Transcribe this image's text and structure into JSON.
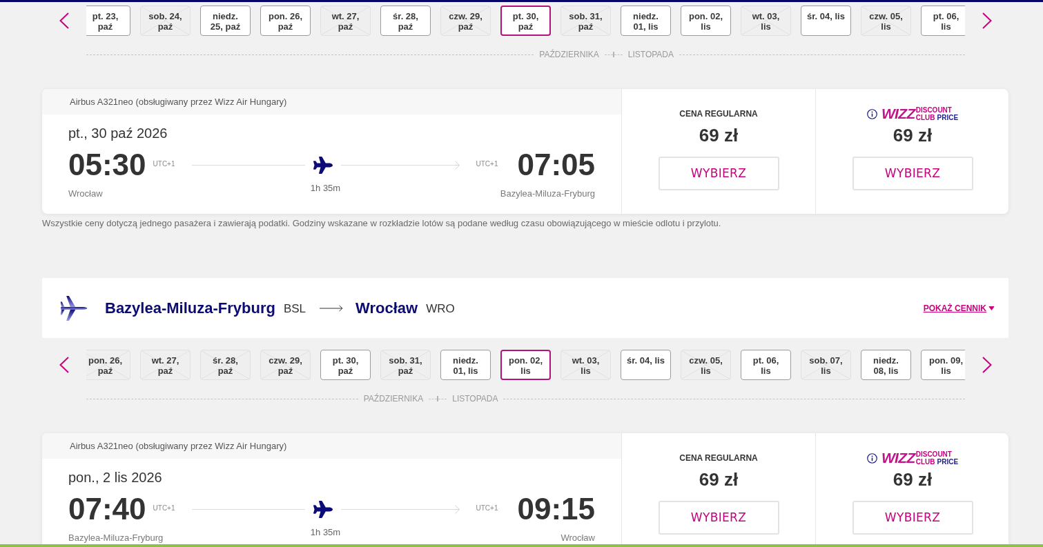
{
  "outbound": {
    "date_strip": {
      "months": [
        {
          "label": "PAŹDZIERNIKA",
          "dates": [
            {
              "label": "pt. 23,\npaź",
              "available": true,
              "selected": false
            },
            {
              "label": "sob. 24,\npaź",
              "available": false,
              "selected": false
            },
            {
              "label": "niedz.\n25, paź",
              "available": true,
              "selected": false
            },
            {
              "label": "pon. 26,\npaź",
              "available": true,
              "selected": false
            },
            {
              "label": "wt. 27,\npaź",
              "available": false,
              "selected": false
            },
            {
              "label": "śr. 28,\npaź",
              "available": true,
              "selected": false
            },
            {
              "label": "czw. 29,\npaź",
              "available": false,
              "selected": false
            },
            {
              "label": "pt. 30,\npaź",
              "available": true,
              "selected": true
            },
            {
              "label": "sob. 31,\npaź",
              "available": false,
              "selected": false
            }
          ]
        },
        {
          "label": "LISTOPADA",
          "dates": [
            {
              "label": "niedz.\n01, lis",
              "available": true,
              "selected": false
            },
            {
              "label": "pon. 02,\nlis",
              "available": true,
              "selected": false
            },
            {
              "label": "wt. 03,\nlis",
              "available": false,
              "selected": false
            },
            {
              "label": "śr. 04, lis",
              "available": true,
              "selected": false
            },
            {
              "label": "czw. 05,\nlis",
              "available": false,
              "selected": false
            },
            {
              "label": "pt. 06,\nlis",
              "available": true,
              "selected": false
            }
          ]
        }
      ]
    },
    "flight": {
      "aircraft": "Airbus A321neo (obsługiwany przez Wizz Air Hungary)",
      "date": "pt., 30 paź 2026",
      "departure": {
        "time": "05:30",
        "timezone": "UTC+1",
        "city": "Wrocław"
      },
      "duration": "1h 35m",
      "arrival": {
        "time": "07:05",
        "timezone": "UTC+1",
        "city": "Bazylea-Miluza-Fryburg"
      },
      "fares": [
        {
          "kind": "regular",
          "label": "CENA REGULARNA",
          "price": "69 zł",
          "button": "WYBIERZ"
        },
        {
          "kind": "club",
          "logo": {
            "wordmark": "WIZZ",
            "top_line": "DISCOUNT",
            "bottom_line": "CLUB",
            "bottom_line_accent": "PRICE"
          },
          "price": "69 zł",
          "button": "WYBIERZ"
        }
      ]
    },
    "note": "Wszystkie ceny dotyczą jednego pasażera i zawierają podatki. Godziny wskazane w rozkładzie lotów są podane według czasu obowiązującego w mieście odlotu i przylotu."
  },
  "inbound": {
    "route": {
      "origin": {
        "city": "Bazylea-Miluza-Fryburg",
        "code": "BSL"
      },
      "destination": {
        "city": "Wrocław",
        "code": "WRO"
      },
      "price_link": "POKAŻ CENNIK"
    },
    "date_strip": {
      "months": [
        {
          "label": "PAŹDZIERNIKA",
          "dates": [
            {
              "label": "pon. 26,\npaź",
              "available": false,
              "selected": false
            },
            {
              "label": "wt. 27,\npaź",
              "available": false,
              "selected": false
            },
            {
              "label": "śr. 28,\npaź",
              "available": false,
              "selected": false
            },
            {
              "label": "czw. 29,\npaź",
              "available": false,
              "selected": false
            },
            {
              "label": "pt. 30,\npaź",
              "available": true,
              "selected": false
            },
            {
              "label": "sob. 31,\npaź",
              "available": false,
              "selected": false
            }
          ]
        },
        {
          "label": "LISTOPADA",
          "dates": [
            {
              "label": "niedz.\n01, lis",
              "available": true,
              "selected": false
            },
            {
              "label": "pon. 02,\nlis",
              "available": true,
              "selected": true
            },
            {
              "label": "wt. 03,\nlis",
              "available": false,
              "selected": false
            },
            {
              "label": "śr. 04, lis",
              "available": true,
              "selected": false
            },
            {
              "label": "czw. 05,\nlis",
              "available": false,
              "selected": false
            },
            {
              "label": "pt. 06,\nlis",
              "available": true,
              "selected": false
            },
            {
              "label": "sob. 07,\nlis",
              "available": false,
              "selected": false
            },
            {
              "label": "niedz.\n08, lis",
              "available": true,
              "selected": false
            },
            {
              "label": "pon. 09,\nlis",
              "available": true,
              "selected": false
            }
          ]
        }
      ]
    },
    "flight": {
      "aircraft": "Airbus A321neo (obsługiwany przez Wizz Air Hungary)",
      "date": "pon., 2 lis 2026",
      "departure": {
        "time": "07:40",
        "timezone": "UTC+1",
        "city": "Bazylea-Miluza-Fryburg"
      },
      "duration": "1h 35m",
      "arrival": {
        "time": "09:15",
        "timezone": "UTC+1",
        "city": "Wrocław"
      },
      "fares": [
        {
          "kind": "regular",
          "label": "CENA REGULARNA",
          "price": "69 zł",
          "button": "WYBIERZ"
        },
        {
          "kind": "club",
          "logo": {
            "wordmark": "WIZZ",
            "top_line": "DISCOUNT",
            "bottom_line": "CLUB",
            "bottom_line_accent": "PRICE"
          },
          "price": "69 zł",
          "button": "WYBIERZ"
        }
      ]
    }
  }
}
